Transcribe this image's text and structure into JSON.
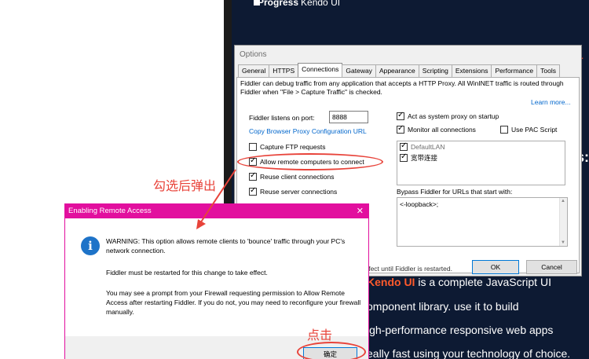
{
  "background": {
    "brand": "Progress",
    "brand_product": "Kendo UI",
    "lines": [
      {
        "brand": "Kendo UI",
        "text": " is a complete JavaScript UI"
      },
      {
        "brand": "",
        "text": "omponent library. use it to build"
      },
      {
        "brand": "",
        "text": "igh-performance responsive web apps"
      },
      {
        "brand": "",
        "text": "eally fast using your technology of choice."
      }
    ],
    "edge_red": "a",
    "edge_white": "s:"
  },
  "options": {
    "title": "Options",
    "tabs": [
      "General",
      "HTTPS",
      "Connections",
      "Gateway",
      "Appearance",
      "Scripting",
      "Extensions",
      "Performance",
      "Tools"
    ],
    "active_tab": "Connections",
    "description": "Fiddler can debug traffic from any application that accepts a HTTP Proxy. All WinINET traffic is routed through Fiddler when \"File > Capture Traffic\" is checked.",
    "learn_more": "Learn more...",
    "port_label": "Fiddler listens on port:",
    "port_value": "8888",
    "copy_link": "Copy Browser Proxy Configuration URL",
    "left_checks": [
      {
        "label": "Capture FTP requests",
        "checked": false
      },
      {
        "label": "Allow remote computers to connect",
        "checked": true
      },
      {
        "label": "Reuse client connections",
        "checked": true
      },
      {
        "label": "Reuse server connections",
        "checked": true
      }
    ],
    "right_checks": [
      {
        "label": "Act as system proxy on startup",
        "checked": true
      },
      {
        "label": "Monitor all connections",
        "checked": true
      },
      {
        "label": "Use PAC Script",
        "checked": false
      }
    ],
    "connections_list": [
      {
        "label": "DefaultLAN",
        "checked": true
      },
      {
        "label": "宽带连接",
        "checked": true
      }
    ],
    "bypass_label": "Bypass Fiddler for URLs that start with:",
    "bypass_value": "<-loopback>;",
    "effect_note": "ffect until Fiddler is restarted.",
    "ok_label": "OK",
    "cancel_label": "Cancel"
  },
  "remote": {
    "title": "Enabling Remote Access",
    "close": "✕",
    "icon": "i",
    "warning": "WARNING: This option allows remote clients to 'bounce' traffic through your PC's network connection.",
    "restart_note": "Fiddler must be restarted for this change to take effect.",
    "firewall_note": "You may see a prompt from your Firewall requesting permission to Allow Remote Access after restarting Fiddler. If you do not, you may need to reconfigure your firewall manually.",
    "confirm_label": "确定"
  },
  "annotations": {
    "after_check": "勾选后弹出",
    "click": "点击",
    "color": "#e8433a"
  }
}
